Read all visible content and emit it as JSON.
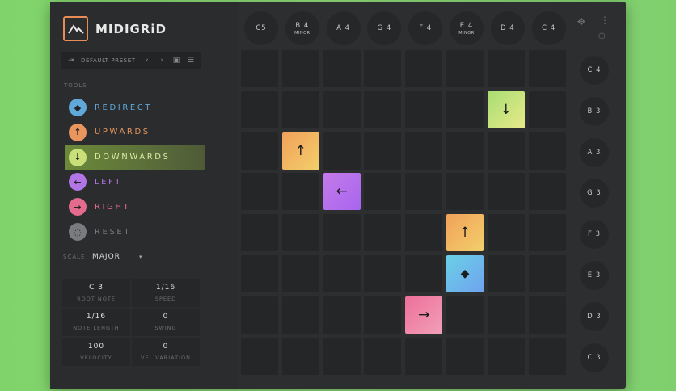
{
  "app": {
    "name": "MIDIGRiD"
  },
  "preset": {
    "name": "DEFAULT PRESET"
  },
  "tools": {
    "section_label": "TOOLS",
    "items": [
      {
        "label": "REDIRECT",
        "color": "#5fa8d8",
        "icon": "diamond-redirect-icon",
        "active": false
      },
      {
        "label": "UPWARDS",
        "color": "#e8955e",
        "icon": "arrow-up-icon",
        "active": false
      },
      {
        "label": "DOWNWARDS",
        "color": "#c9e07a",
        "icon": "arrow-down-icon",
        "active": true
      },
      {
        "label": "LEFT",
        "color": "#b275e6",
        "icon": "arrow-left-icon",
        "active": false
      },
      {
        "label": "RIGHT",
        "color": "#e56b8e",
        "icon": "arrow-right-icon",
        "active": false
      },
      {
        "label": "RESET",
        "color": "#7a7b7e",
        "icon": "reset-icon",
        "active": false
      }
    ]
  },
  "scale": {
    "label": "SCALE",
    "value": "MAJOR"
  },
  "params": [
    {
      "value": "C 3",
      "label": "ROOT NOTE"
    },
    {
      "value": "1/16",
      "label": "SPEED"
    },
    {
      "value": "1/16",
      "label": "NOTE LENGTH"
    },
    {
      "value": "0",
      "label": "SWING"
    },
    {
      "value": "100",
      "label": "VELOCITY"
    },
    {
      "value": "0",
      "label": "VEL VARIATION"
    }
  ],
  "top_notes": [
    {
      "note": "C5",
      "sub": ""
    },
    {
      "note": "B 4",
      "sub": "MINOR"
    },
    {
      "note": "A 4",
      "sub": ""
    },
    {
      "note": "G 4",
      "sub": ""
    },
    {
      "note": "F 4",
      "sub": ""
    },
    {
      "note": "E 4",
      "sub": "MINOR"
    },
    {
      "note": "D 4",
      "sub": ""
    },
    {
      "note": "C 4",
      "sub": ""
    }
  ],
  "side_notes": [
    "C 4",
    "B 3",
    "A 3",
    "G 3",
    "F 3",
    "E 3",
    "D 3",
    "C 3"
  ],
  "grid": {
    "rows": 8,
    "cols": 8,
    "cells": [
      {
        "row": 1,
        "col": 6,
        "tool": "down"
      },
      {
        "row": 2,
        "col": 1,
        "tool": "up"
      },
      {
        "row": 3,
        "col": 2,
        "tool": "left"
      },
      {
        "row": 4,
        "col": 5,
        "tool": "up"
      },
      {
        "row": 5,
        "col": 5,
        "tool": "redirect"
      },
      {
        "row": 6,
        "col": 4,
        "tool": "right"
      }
    ]
  },
  "tool_styles": {
    "up": {
      "gradient": [
        "#f1a15a",
        "#f2cf6a"
      ],
      "glyph": "↑",
      "icon": "arrow-up-icon"
    },
    "down": {
      "gradient": [
        "#a8dd73",
        "#e8ea8a"
      ],
      "glyph": "↓",
      "icon": "arrow-down-icon"
    },
    "left": {
      "gradient": [
        "#c57ae8",
        "#a766f0"
      ],
      "glyph": "←",
      "icon": "arrow-left-icon"
    },
    "right": {
      "gradient": [
        "#ee6f9a",
        "#f1a0b8"
      ],
      "glyph": "→",
      "icon": "arrow-right-icon"
    },
    "redirect": {
      "gradient": [
        "#6ad0e6",
        "#6fa3ef"
      ],
      "glyph": "◆",
      "icon": "diamond-redirect-icon"
    }
  }
}
